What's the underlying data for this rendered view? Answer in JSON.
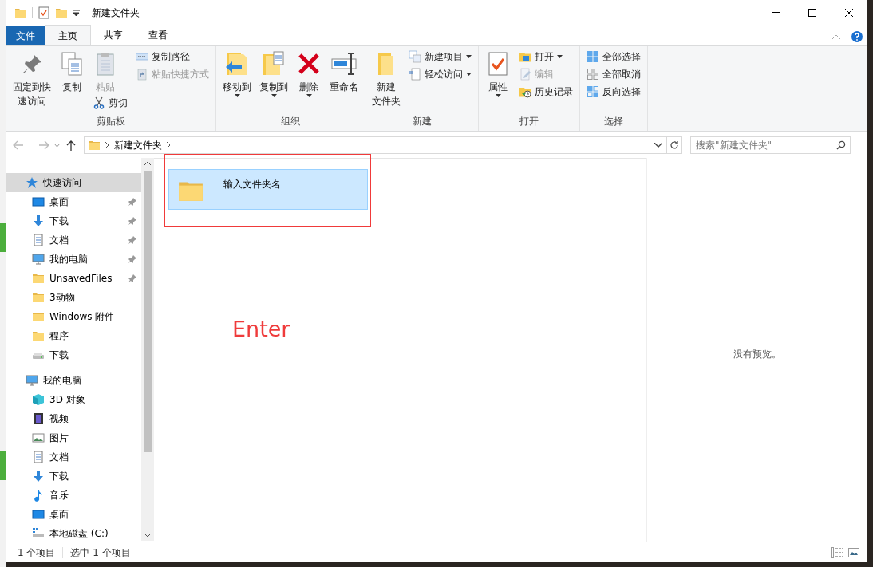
{
  "window": {
    "title": "新建文件夹"
  },
  "ribbon_tabs": [
    {
      "label": "文件",
      "kind": "file",
      "selected": false
    },
    {
      "label": "主页",
      "kind": "tab",
      "selected": true
    },
    {
      "label": "共享",
      "kind": "tab",
      "selected": false
    },
    {
      "label": "查看",
      "kind": "tab",
      "selected": false
    }
  ],
  "ribbon_groups": [
    {
      "label": "剪贴板",
      "columns": [
        [
          {
            "lines": [
              "固定到快",
              "速访问"
            ],
            "kind": "large",
            "disabled": false,
            "dropdown": false
          }
        ],
        [
          {
            "label": "复制",
            "kind": "large",
            "disabled": false,
            "dropdown": false
          }
        ],
        [
          {
            "label": "粘贴",
            "kind": "large",
            "disabled": true,
            "dropdown": false
          },
          {
            "label": "剪切",
            "kind": "small",
            "disabled": false,
            "dropdown": false
          }
        ],
        [
          {
            "label": "复制路径",
            "kind": "small",
            "disabled": false,
            "dropdown": false
          },
          {
            "label": "粘贴快捷方式",
            "kind": "small",
            "disabled": true,
            "dropdown": false
          }
        ]
      ]
    },
    {
      "label": "组织",
      "columns": [
        [
          {
            "label": "移动到",
            "kind": "large",
            "disabled": false,
            "dropdown": true
          }
        ],
        [
          {
            "label": "复制到",
            "kind": "large",
            "disabled": false,
            "dropdown": true
          }
        ],
        [
          {
            "label": "删除",
            "kind": "large",
            "disabled": false,
            "dropdown": true
          }
        ],
        [
          {
            "label": "重命名",
            "kind": "large",
            "disabled": false,
            "dropdown": false
          }
        ]
      ]
    },
    {
      "label": "新建",
      "columns": [
        [
          {
            "lines": [
              "新建",
              "文件夹"
            ],
            "kind": "large",
            "disabled": false,
            "dropdown": false
          }
        ],
        [
          {
            "label": "新建项目",
            "kind": "small",
            "disabled": false,
            "dropdown": true
          },
          {
            "label": "轻松访问",
            "kind": "small",
            "disabled": false,
            "dropdown": true
          }
        ]
      ]
    },
    {
      "label": "打开",
      "columns": [
        [
          {
            "label": "属性",
            "kind": "large",
            "disabled": false,
            "dropdown": true
          }
        ],
        [
          {
            "label": "打开",
            "kind": "small",
            "disabled": false,
            "dropdown": true
          },
          {
            "label": "编辑",
            "kind": "small",
            "disabled": true,
            "dropdown": false
          },
          {
            "label": "历史记录",
            "kind": "small",
            "disabled": false,
            "dropdown": false
          }
        ]
      ]
    },
    {
      "label": "选择",
      "columns": [
        [
          {
            "label": "全部选择",
            "kind": "small",
            "disabled": false,
            "dropdown": false
          },
          {
            "label": "全部取消",
            "kind": "small",
            "disabled": false,
            "dropdown": false
          },
          {
            "label": "反向选择",
            "kind": "small",
            "disabled": false,
            "dropdown": false
          }
        ]
      ]
    }
  ],
  "address_bar": {
    "path": [
      "新建文件夹"
    ]
  },
  "search": {
    "placeholder": "搜索\"新建文件夹\""
  },
  "navigation": [
    {
      "label": "快速访问",
      "selected": true,
      "children": [
        {
          "label": "桌面",
          "pinned": true
        },
        {
          "label": "下载",
          "pinned": true
        },
        {
          "label": "文档",
          "pinned": true
        },
        {
          "label": "我的电脑",
          "pinned": true
        },
        {
          "label": "UnsavedFiles",
          "pinned": true
        },
        {
          "label": "3动物",
          "pinned": false
        },
        {
          "label": "Windows 附件",
          "pinned": false
        },
        {
          "label": "程序",
          "pinned": false
        },
        {
          "label": "下载",
          "pinned": false
        }
      ]
    },
    {
      "label": "我的电脑",
      "selected": false,
      "children": [
        {
          "label": "3D 对象",
          "pinned": false
        },
        {
          "label": "视频",
          "pinned": false
        },
        {
          "label": "图片",
          "pinned": false
        },
        {
          "label": "文档",
          "pinned": false
        },
        {
          "label": "下载",
          "pinned": false
        },
        {
          "label": "音乐",
          "pinned": false
        },
        {
          "label": "桌面",
          "pinned": false
        },
        {
          "label": "本地磁盘 (C:)",
          "pinned": false
        }
      ]
    }
  ],
  "items": [
    {
      "name": "输入文件夹名",
      "selected": true
    }
  ],
  "annotation": {
    "text": "Enter"
  },
  "preview": {
    "text": "没有预览。"
  },
  "status_bar": {
    "item_count": "1 个项目",
    "selection": "选中 1 个项目"
  }
}
